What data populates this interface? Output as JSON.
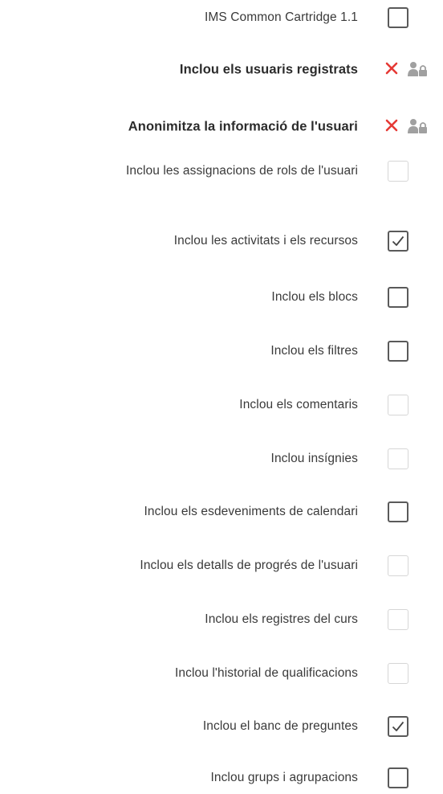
{
  "options": [
    {
      "label": "IMS Common Cartridge 1.1",
      "kind": "checkbox",
      "state": "unchecked"
    },
    {
      "label": "Inclou els usuaris registrats",
      "kind": "locked",
      "state": "locked-no"
    },
    {
      "label": "Anonimitza la informació de l'usuari",
      "kind": "locked",
      "state": "locked-no"
    },
    {
      "label": "Inclou les assignacions de rols de l'usuari",
      "kind": "checkbox",
      "state": "disabled"
    },
    {
      "label": "Inclou les activitats i els recursos",
      "kind": "checkbox",
      "state": "checked"
    },
    {
      "label": "Inclou els blocs",
      "kind": "checkbox",
      "state": "unchecked"
    },
    {
      "label": "Inclou els filtres",
      "kind": "checkbox",
      "state": "unchecked"
    },
    {
      "label": "Inclou els comentaris",
      "kind": "checkbox",
      "state": "disabled"
    },
    {
      "label": "Inclou insígnies",
      "kind": "checkbox",
      "state": "disabled"
    },
    {
      "label": "Inclou els esdeveniments de calendari",
      "kind": "checkbox",
      "state": "unchecked"
    },
    {
      "label": "Inclou els detalls de progrés de l'usuari",
      "kind": "checkbox",
      "state": "disabled"
    },
    {
      "label": "Inclou els registres del curs",
      "kind": "checkbox",
      "state": "disabled"
    },
    {
      "label": "Inclou l'historial de qualificacions",
      "kind": "checkbox",
      "state": "disabled"
    },
    {
      "label": "Inclou el banc de preguntes",
      "kind": "checkbox",
      "state": "checked"
    },
    {
      "label": "Inclou grups i agrupacions",
      "kind": "checkbox",
      "state": "unchecked"
    }
  ],
  "icons": {
    "locked_no": "cross-icon",
    "locked_user": "user-lock-icon",
    "checked": "checkmark-icon"
  },
  "colors": {
    "cross": "#e53935",
    "lock_icon": "#a0a0a0",
    "checkbox_border": "#5a5a5a",
    "checkbox_disabled_border": "#d6d6d6"
  }
}
